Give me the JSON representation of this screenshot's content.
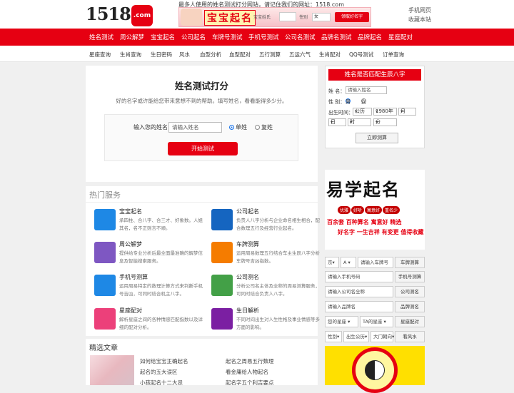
{
  "header": {
    "logo_text": "1518",
    "logo_com": ".com",
    "slogan": "最多人使用的姓名测试打分网站，请记住我们的网址：1518.com",
    "banner_title": "宝宝起名",
    "banner_field1": "宝宝姓氏",
    "banner_field2": "性别",
    "banner_select": "女",
    "banner_button": "领取好名字",
    "links": [
      "手机网页",
      "收藏本站"
    ]
  },
  "nav_primary": [
    "姓名测试",
    "周公解梦",
    "宝宝起名",
    "公司起名",
    "车牌号测试",
    "手机号测试",
    "公司名测试",
    "品牌名测试",
    "品牌起名",
    "星座配对"
  ],
  "nav_secondary": [
    "星座查询",
    "生肖查询",
    "生日密码",
    "风水",
    "血型分析",
    "血型配对",
    "五行测算",
    "五运六气",
    "生肖配对",
    "QQ号测试",
    "订单查询"
  ],
  "main_card": {
    "title": "姓名测试打分",
    "desc": "好的名字或许能给您带来意想不到的帮助。填写姓名，看看能得多少分。",
    "label": "输入您的姓名",
    "placeholder": "请输入姓名",
    "opt_single": "单姓",
    "opt_double": "复姓",
    "submit": "开始测试"
  },
  "hot": {
    "title": "热门服务",
    "items": [
      {
        "name": "宝宝起名",
        "desc": "承四柱、合八字、合三才、好象数。人姐其名，名不正则言不顺。",
        "color": "#1e88e5",
        "icon": "baby-bottle-icon"
      },
      {
        "name": "公司起名",
        "desc": "负责人八字分析与企业命名相生相合，配合数理五行及经营行业起名。",
        "color": "#1565c0",
        "icon": "building-icon"
      },
      {
        "name": "周公解梦",
        "desc": "提供给专业分析后最全面最准确的解梦信息及智能搜索服务。",
        "color": "#7e57c2",
        "icon": "book-icon"
      },
      {
        "name": "车牌测算",
        "desc": "运用周易数理五行结合车主生辰八字分析车牌号吉凶指数。",
        "color": "#f57c00",
        "icon": "taiji-icon"
      },
      {
        "name": "手机号测算",
        "desc": "运用周易特定的数理计算方式来判断手机号吉凶，可同时结合机主八字。",
        "color": "#1e88e5",
        "icon": "phone-icon"
      },
      {
        "name": "公司测名",
        "desc": "分析公司名主体及全称的周易测算服务，可同时结合负责人八字。",
        "color": "#43a047",
        "icon": "document-icon"
      },
      {
        "name": "星座配对",
        "desc": "解析星座之间的各种情感匹配指数以及详细的配对分析。",
        "color": "#ec407a",
        "icon": "hearts-icon"
      },
      {
        "name": "生日解析",
        "desc": "不同时间出生对人生性格及事业情感等多方面的影响。",
        "color": "#7b1fa2",
        "icon": "cake-icon"
      }
    ]
  },
  "articles": {
    "title": "精选文章",
    "items": [
      "如何给宝宝正确起名",
      "起名之周易五行数理",
      "起名的五大误区",
      "看金庸给人物起名",
      "小孩起名十二大忌",
      "起名字五个利吉要点"
    ]
  },
  "sidebar_form": {
    "title": "姓名是否匹配生辰八字",
    "name_label": "姓 名：",
    "name_placeholder": "请输入姓名",
    "gender_label": "性 别：",
    "male": "男",
    "female": "女",
    "birth_label": "出生时间：",
    "calendar": "公历",
    "year": "1980年",
    "month": "月",
    "day": "日",
    "hour": "时",
    "minute": "分",
    "submit": "立即测算"
  },
  "sidebar_ad": {
    "title": "易学起名",
    "pills": [
      "优雅",
      "好听",
      "寓意好",
      "重名少"
    ],
    "line1": "百余套 百种算名  寓意好 精选",
    "line2": "好名字 一生吉祥  有变更 值得收藏"
  },
  "quick_tools": [
    {
      "select1": "京",
      "select2": "A",
      "input": "请输入车牌号",
      "button": "车牌测算"
    },
    {
      "input": "请输入手机号码",
      "button": "手机号测算"
    },
    {
      "input": "请输入公司名全称",
      "button": "公司测名"
    },
    {
      "input": "请输入品牌名",
      "button": "品牌测名"
    },
    {
      "select1": "您的星座",
      "select2": "TA的星座",
      "button": "星座配对"
    },
    {
      "select1": "性别",
      "select2": "出生公历",
      "select3": "大门朝向",
      "button": "看风水"
    }
  ]
}
